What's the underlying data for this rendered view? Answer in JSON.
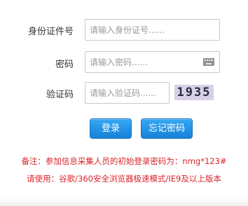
{
  "form": {
    "id_label": "身份证件号",
    "id_placeholder": "请输入身份证号......",
    "password_label": "密码",
    "password_placeholder": "请输入密码......",
    "captcha_label": "验证码",
    "captcha_placeholder": "请输入验证码......",
    "captcha_text": "1935"
  },
  "buttons": {
    "login": "登录",
    "forgot": "忘记密码"
  },
  "notes": {
    "line1": "备注：参加信息采集人员的初始登录密码为：nmg*123#",
    "line2": "请使用：谷歌/360安全浏览器极速模式/IE9及以上版本"
  },
  "colors": {
    "accent": "#1e8ee4",
    "note_red": "#d9232a"
  },
  "icons": {
    "keyboard": "keyboard-icon"
  }
}
